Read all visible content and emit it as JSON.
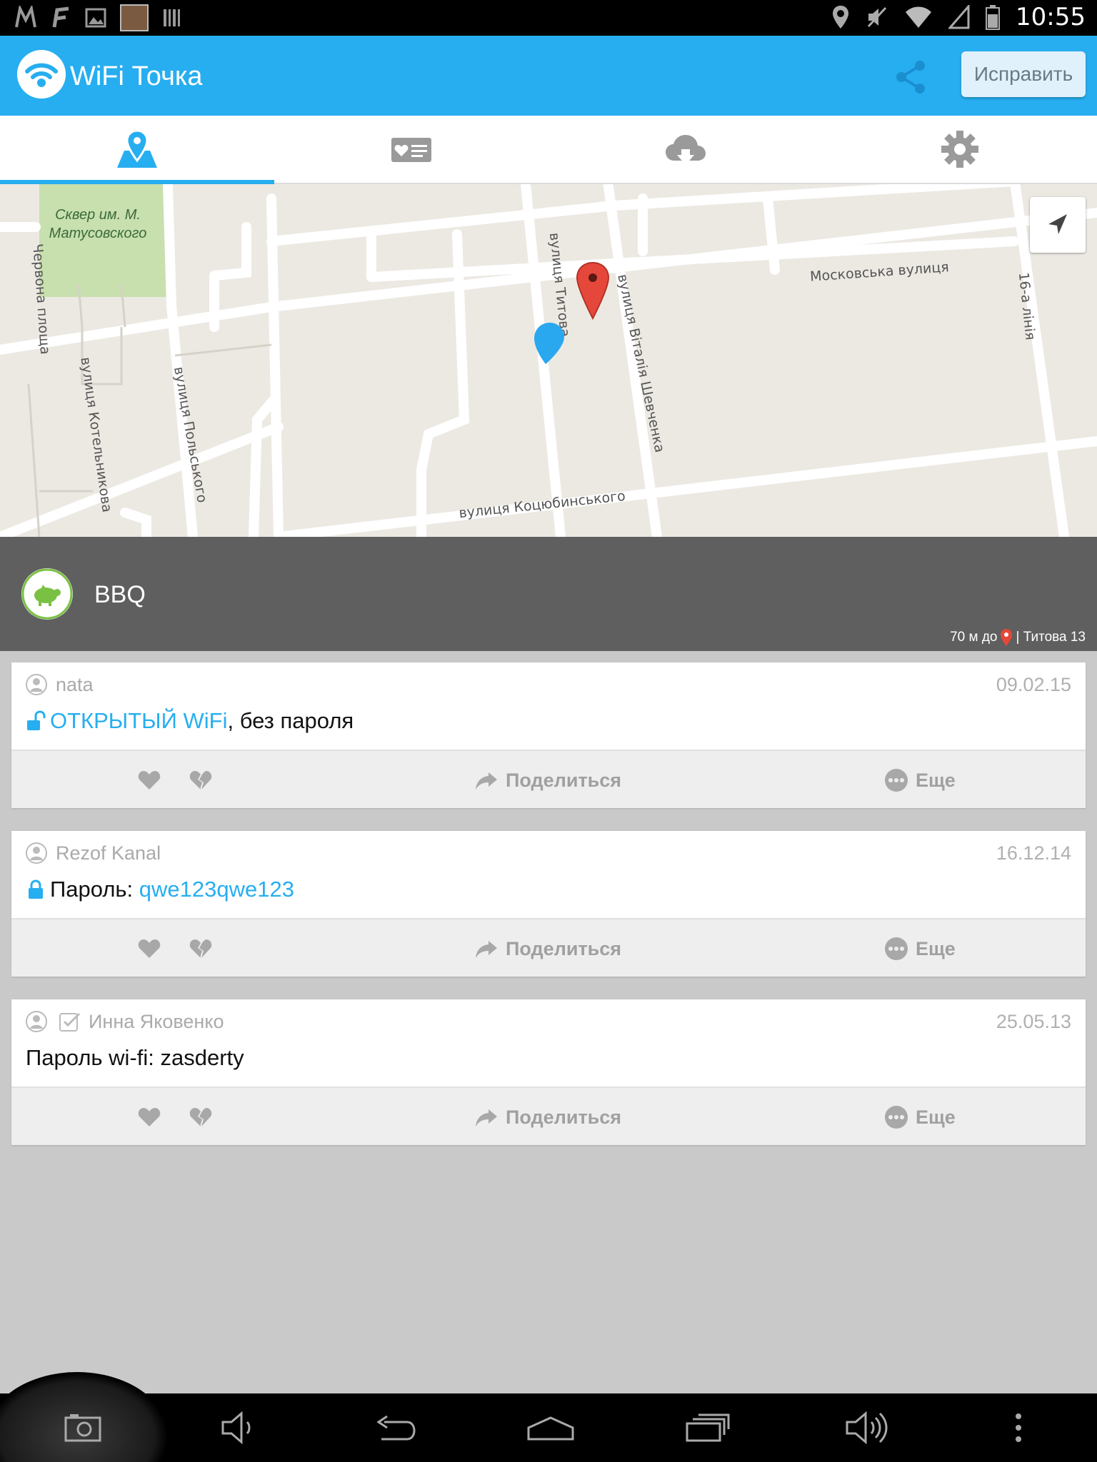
{
  "status_bar": {
    "time": "10:55",
    "left_icons": [
      "m-icon",
      "f-icon",
      "gallery-icon",
      "thumbnail",
      "barcode-icon"
    ],
    "right_icons": [
      "location-icon",
      "mute-icon",
      "wifi-icon",
      "signal-icon",
      "battery-icon"
    ]
  },
  "action_bar": {
    "title": "WiFi Точка",
    "fix_button": "Исправить",
    "share_icon": "share-icon"
  },
  "tabs": [
    {
      "icon": "map-icon",
      "active": true
    },
    {
      "icon": "favorites-card-icon",
      "active": false
    },
    {
      "icon": "cloud-download-icon",
      "active": false
    },
    {
      "icon": "settings-gear-icon",
      "active": false
    }
  ],
  "map": {
    "park_label": "Сквер им. М. Матусовского",
    "streets": {
      "chervona": "Червона площа",
      "kotelnikova": "вулиця Котельникова",
      "polskogo": "вулиця Польського",
      "titova": "вулиця Титова",
      "shevchenka": "вулиця Віталія Шевченка",
      "moskovska": "Московська вулиця",
      "liniya16a": "16-а лінія",
      "kotsyubinskogo": "вулиця Коцюбинського"
    }
  },
  "place": {
    "name": "BBQ",
    "distance_prefix": "70 м до",
    "address": "| Титова 13"
  },
  "cards": [
    {
      "user": "nata",
      "date": "09.02.15",
      "body_link": "ОТКРЫТЫЙ WiFi",
      "body_text": ", без пароля"
    },
    {
      "user": "Rezof Kanal",
      "date": "16.12.14",
      "body_label": "Пароль: ",
      "body_link": "qwe123qwe123"
    },
    {
      "user": "Инна Яковенко",
      "date": "25.05.13",
      "body_text": "Пароль wi-fi: zasderty"
    }
  ],
  "card_actions": {
    "share": "Поделиться",
    "more": "Еще"
  },
  "colors": {
    "accent": "#27aef0",
    "place_header": "#5f5f5f",
    "pin_red": "#e5483a",
    "pin_blue": "#29a8f0",
    "pig_green": "#7ac143"
  }
}
